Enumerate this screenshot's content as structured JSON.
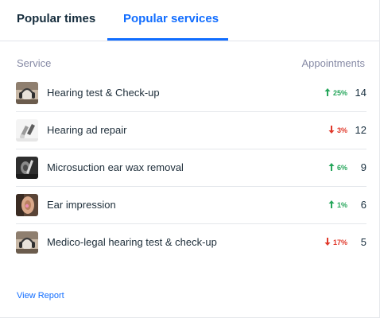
{
  "tabs": [
    {
      "label": "Popular times",
      "active": false
    },
    {
      "label": "Popular services",
      "active": true
    }
  ],
  "table": {
    "header_service": "Service",
    "header_appointments": "Appointments"
  },
  "services": [
    {
      "name": "Hearing test & Check-up",
      "trend": "25%",
      "direction": "up",
      "count": "14",
      "thumbnail": "hearing-test-thumbnail"
    },
    {
      "name": "Hearing ad repair",
      "trend": "3%",
      "direction": "down",
      "count": "12",
      "thumbnail": "hearing-aid-repair-thumbnail"
    },
    {
      "name": "Microsuction ear wax removal",
      "trend": "6%",
      "direction": "up",
      "count": "9",
      "thumbnail": "microsuction-thumbnail"
    },
    {
      "name": "Ear impression",
      "trend": "1%",
      "direction": "up",
      "count": "6",
      "thumbnail": "ear-impression-thumbnail"
    },
    {
      "name": "Medico-legal hearing test & check-up",
      "trend": "17%",
      "direction": "down",
      "count": "5",
      "thumbnail": "medico-legal-thumbnail"
    }
  ],
  "footer": {
    "view_report": "View Report"
  },
  "colors": {
    "accent": "#116dff",
    "up": "#26a65b",
    "down": "#e0382a",
    "muted": "#868aa5"
  }
}
